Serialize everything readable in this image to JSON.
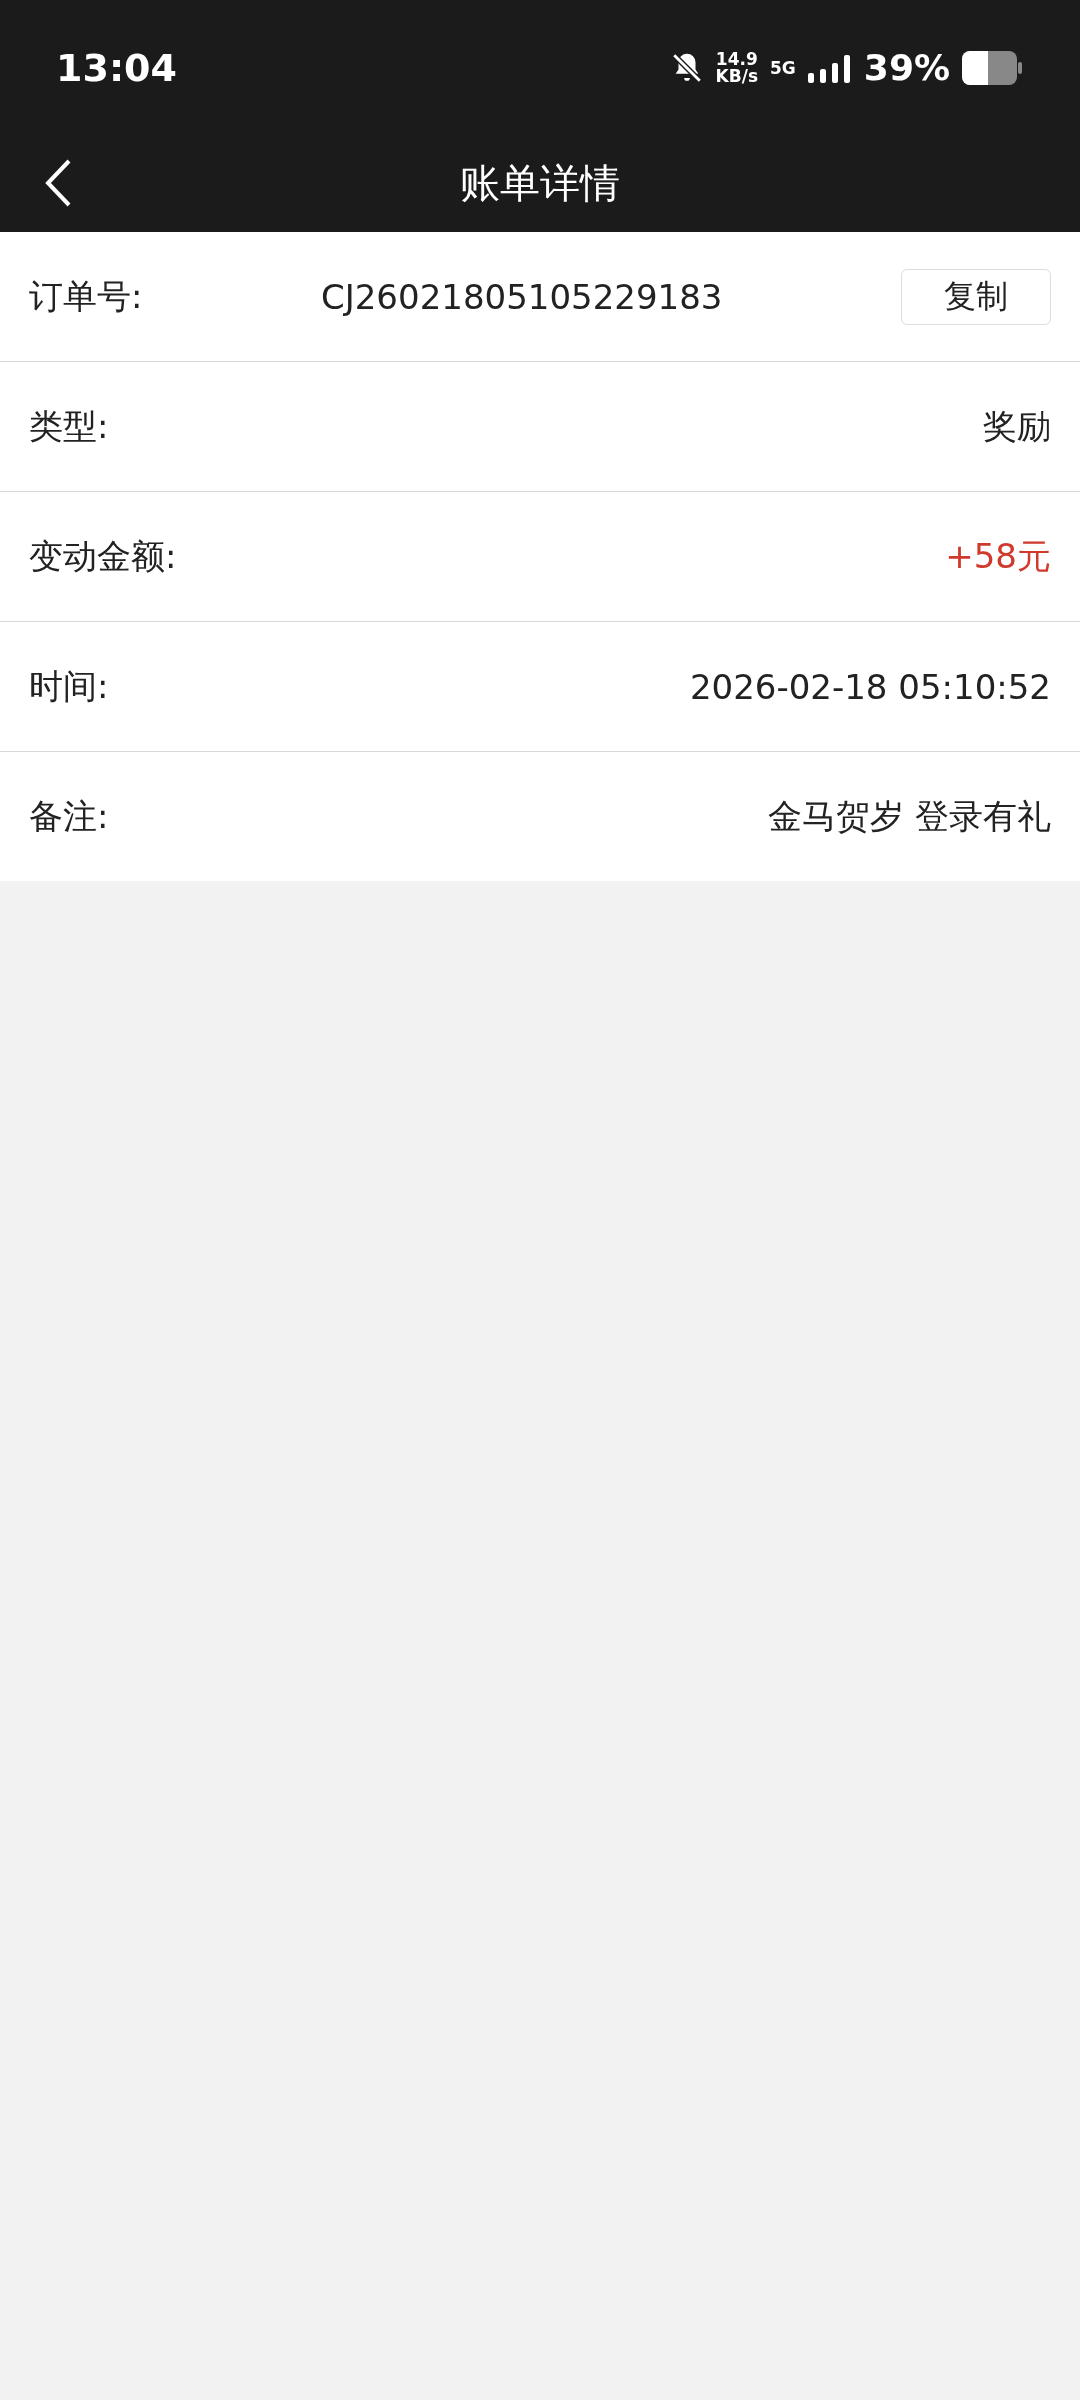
{
  "status_bar": {
    "time": "13:04",
    "speed": "14.9",
    "speed_unit": "KB/s",
    "network": "5G",
    "battery": "39%"
  },
  "header": {
    "title": "账单详情"
  },
  "rows": [
    {
      "kind": "copyable",
      "label": "订单号:",
      "value": "CJ26021805105229183",
      "button": "复制"
    },
    {
      "kind": "text",
      "label": "类型:",
      "value": "奖励"
    },
    {
      "kind": "highlight",
      "label": "变动金额:",
      "value": "+58元"
    },
    {
      "kind": "text",
      "label": "时间:",
      "value": "2026-02-18 05:10:52"
    },
    {
      "kind": "text",
      "label": "备注:",
      "value": "金马贺岁 登录有礼"
    }
  ]
}
